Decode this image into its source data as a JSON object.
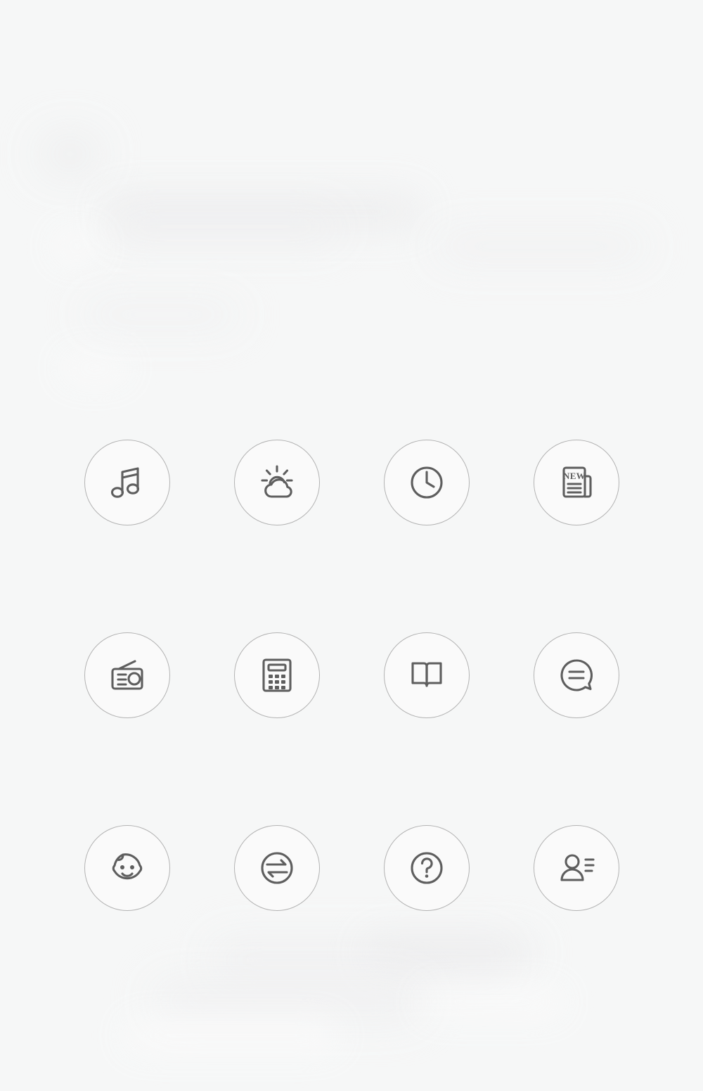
{
  "page": {
    "background_color": "#f6f7f7",
    "circle_border_color": "#b3b3b3",
    "icon_stroke_color": "#5e5e5e",
    "columns": 4,
    "rows": 3
  },
  "icons": [
    {
      "name": "music-note-icon",
      "label": "Music",
      "row": 1,
      "col": 1
    },
    {
      "name": "weather-icon",
      "label": "Weather",
      "row": 1,
      "col": 2
    },
    {
      "name": "clock-icon",
      "label": "Clock",
      "row": 1,
      "col": 3
    },
    {
      "name": "newspaper-icon",
      "label": "News",
      "row": 1,
      "col": 4,
      "text": "NEW"
    },
    {
      "name": "radio-icon",
      "label": "Radio",
      "row": 2,
      "col": 1
    },
    {
      "name": "calculator-icon",
      "label": "Calculator",
      "row": 2,
      "col": 2
    },
    {
      "name": "open-book-icon",
      "label": "Book",
      "row": 2,
      "col": 3
    },
    {
      "name": "chat-bubble-icon",
      "label": "Chat",
      "row": 2,
      "col": 4
    },
    {
      "name": "baby-face-icon",
      "label": "Baby",
      "row": 3,
      "col": 1
    },
    {
      "name": "transfer-arrows-icon",
      "label": "Transfer",
      "row": 3,
      "col": 2
    },
    {
      "name": "help-question-icon",
      "label": "Help",
      "row": 3,
      "col": 3
    },
    {
      "name": "contact-person-icon",
      "label": "Contact",
      "row": 3,
      "col": 4
    }
  ]
}
